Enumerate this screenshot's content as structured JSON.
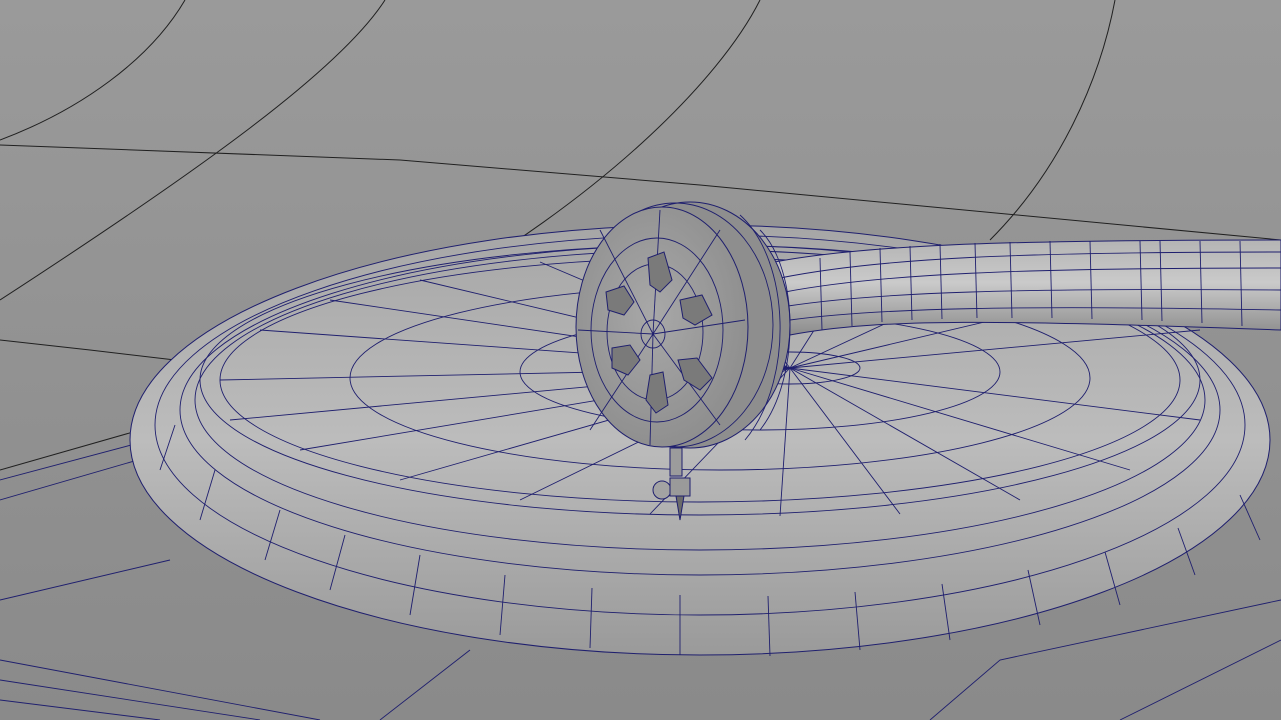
{
  "viewport": {
    "label": "",
    "shading": "wireframe-on-shaded",
    "wire_color": "#1f1f6e",
    "background_color": "#8f8f8f"
  },
  "scene": {
    "objects": [
      "ground-plane",
      "turntable-base",
      "record-platter",
      "tonearm-tube",
      "reproducer-soundbox",
      "stylus-needle"
    ]
  }
}
